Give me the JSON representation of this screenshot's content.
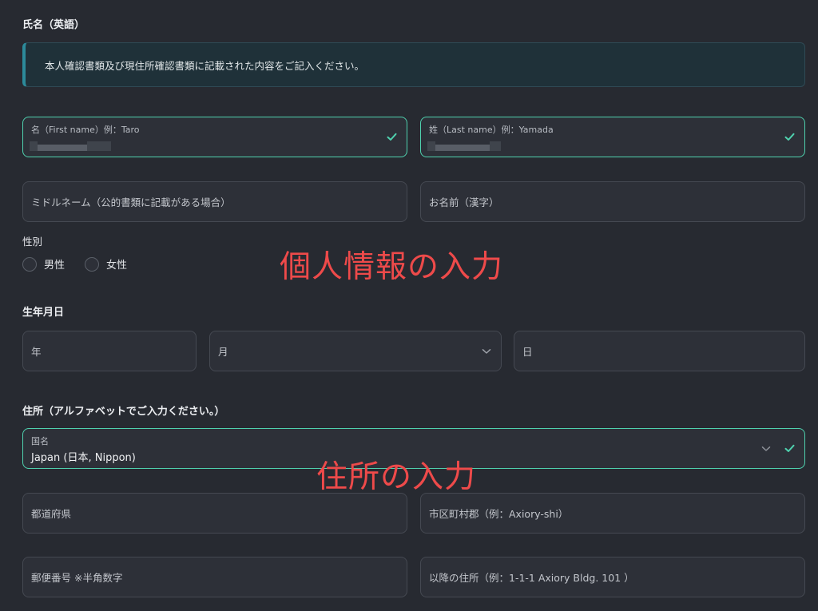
{
  "name_section": {
    "title": "氏名（英語）",
    "notice": "本人確認書類及び現住所確認書類に記載された内容をご記入ください。",
    "first_name_label": "名（First name）例：Taro",
    "last_name_label": "姓（Last name）例：Yamada",
    "middle_name_placeholder": "ミドルネーム（公的書類に記載がある場合）",
    "kanji_name_placeholder": "お名前（漢字）"
  },
  "gender": {
    "title": "性別",
    "options": [
      "男性",
      "女性"
    ]
  },
  "birth": {
    "title": "生年月日",
    "year_placeholder": "年",
    "month_placeholder": "月",
    "day_placeholder": "日"
  },
  "address": {
    "title": "住所（アルファベットでご入力ください。）",
    "country_label": "国名",
    "country_value": "Japan (日本, Nippon)",
    "prefecture_placeholder": "都道府県",
    "city_placeholder": "市区町村郡（例：Axiory-shi）",
    "postal_placeholder": "郵便番号 ※半角数字",
    "street_placeholder": "以降の住所（例：1-1-1 Axiory Bldg. 101 ）"
  },
  "annotations": {
    "personal_info": "個人情報の入力",
    "address_input": "住所の入力"
  },
  "colors": {
    "background": "#272a31",
    "valid_border": "#4fd1ae",
    "annotation_red": "#ee4a4a"
  },
  "icons": {
    "valid": "check-icon",
    "dropdown": "chevron-down-icon"
  }
}
